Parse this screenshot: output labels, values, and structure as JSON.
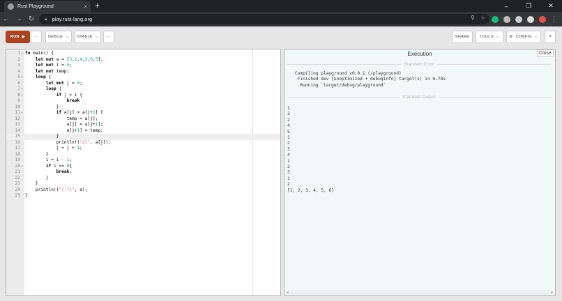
{
  "browser": {
    "tab_title": "Rust Playground",
    "tab_close": "×",
    "new_tab": "+",
    "url": "play.rust-lang.org",
    "win_min": "–",
    "win_max": "❐",
    "win_close": "✕",
    "ext_colors": [
      "#1fb97f",
      "#bdbdbd",
      "#cfcfcf",
      "#dcdcdc",
      "#e05252"
    ]
  },
  "header": {
    "run": "RUN",
    "more1": "···",
    "debug": "DEBUG",
    "stable": "STABLE",
    "more2": "···",
    "share": "SHARE",
    "tools": "TOOLS",
    "config": "CONFIG",
    "help": "?"
  },
  "editor": {
    "lines": [
      {
        "n": "1",
        "fold": true,
        "code": "fn main() {"
      },
      {
        "n": "2",
        "fold": false,
        "code": "    let mut a = [3,1,4,2,6,5];"
      },
      {
        "n": "3",
        "fold": false,
        "code": "    let mut i = 4;"
      },
      {
        "n": "4",
        "fold": false,
        "code": "    let mut temp;"
      },
      {
        "n": "5",
        "fold": true,
        "code": "    loop {"
      },
      {
        "n": "6",
        "fold": false,
        "code": "        let mut j = 0;"
      },
      {
        "n": "7",
        "fold": true,
        "code": "        loop {"
      },
      {
        "n": "8",
        "fold": true,
        "code": "            if j > i {"
      },
      {
        "n": "9",
        "fold": false,
        "code": "                break"
      },
      {
        "n": "10",
        "fold": false,
        "code": "            }"
      },
      {
        "n": "11",
        "fold": true,
        "code": "            if a[j] > a[j+1] {"
      },
      {
        "n": "12",
        "fold": false,
        "code": "                temp = a[j];"
      },
      {
        "n": "13",
        "fold": false,
        "code": "                a[j] = a[j+1];"
      },
      {
        "n": "14",
        "fold": false,
        "code": "                a[j+1] = temp;"
      },
      {
        "n": "15",
        "fold": false,
        "code": "            }",
        "highlight": true
      },
      {
        "n": "16",
        "fold": false,
        "code": "            println!(\"{}\", a[j]);"
      },
      {
        "n": "17",
        "fold": false,
        "code": "            j = j + 1;"
      },
      {
        "n": "18",
        "fold": false,
        "code": "        }"
      },
      {
        "n": "19",
        "fold": false,
        "code": "        i = i - 1;"
      },
      {
        "n": "20",
        "fold": true,
        "code": "        if i <= 0{"
      },
      {
        "n": "21",
        "fold": false,
        "code": "            break;"
      },
      {
        "n": "22",
        "fold": false,
        "code": "        }"
      },
      {
        "n": "23",
        "fold": false,
        "code": "    }"
      },
      {
        "n": "24",
        "fold": false,
        "code": "    println!(\"{:?}\", a);"
      },
      {
        "n": "25",
        "fold": false,
        "code": "}"
      }
    ]
  },
  "output": {
    "title": "Execution",
    "close": "Close",
    "stderr_label": "Standard Error",
    "stderr": "Compiling playground v0.0.1 (/playground)\n Finished dev [unoptimized + debuginfo] target(s) in 0.78s\n  Running `target/debug/playground`",
    "stdout_label": "Standard Output",
    "stdout": "1\n3\n2\n4\n5\n1\n2\n3\n4\n1\n2\n3\n1\n2\n[1, 2, 3, 4, 5, 6]"
  }
}
